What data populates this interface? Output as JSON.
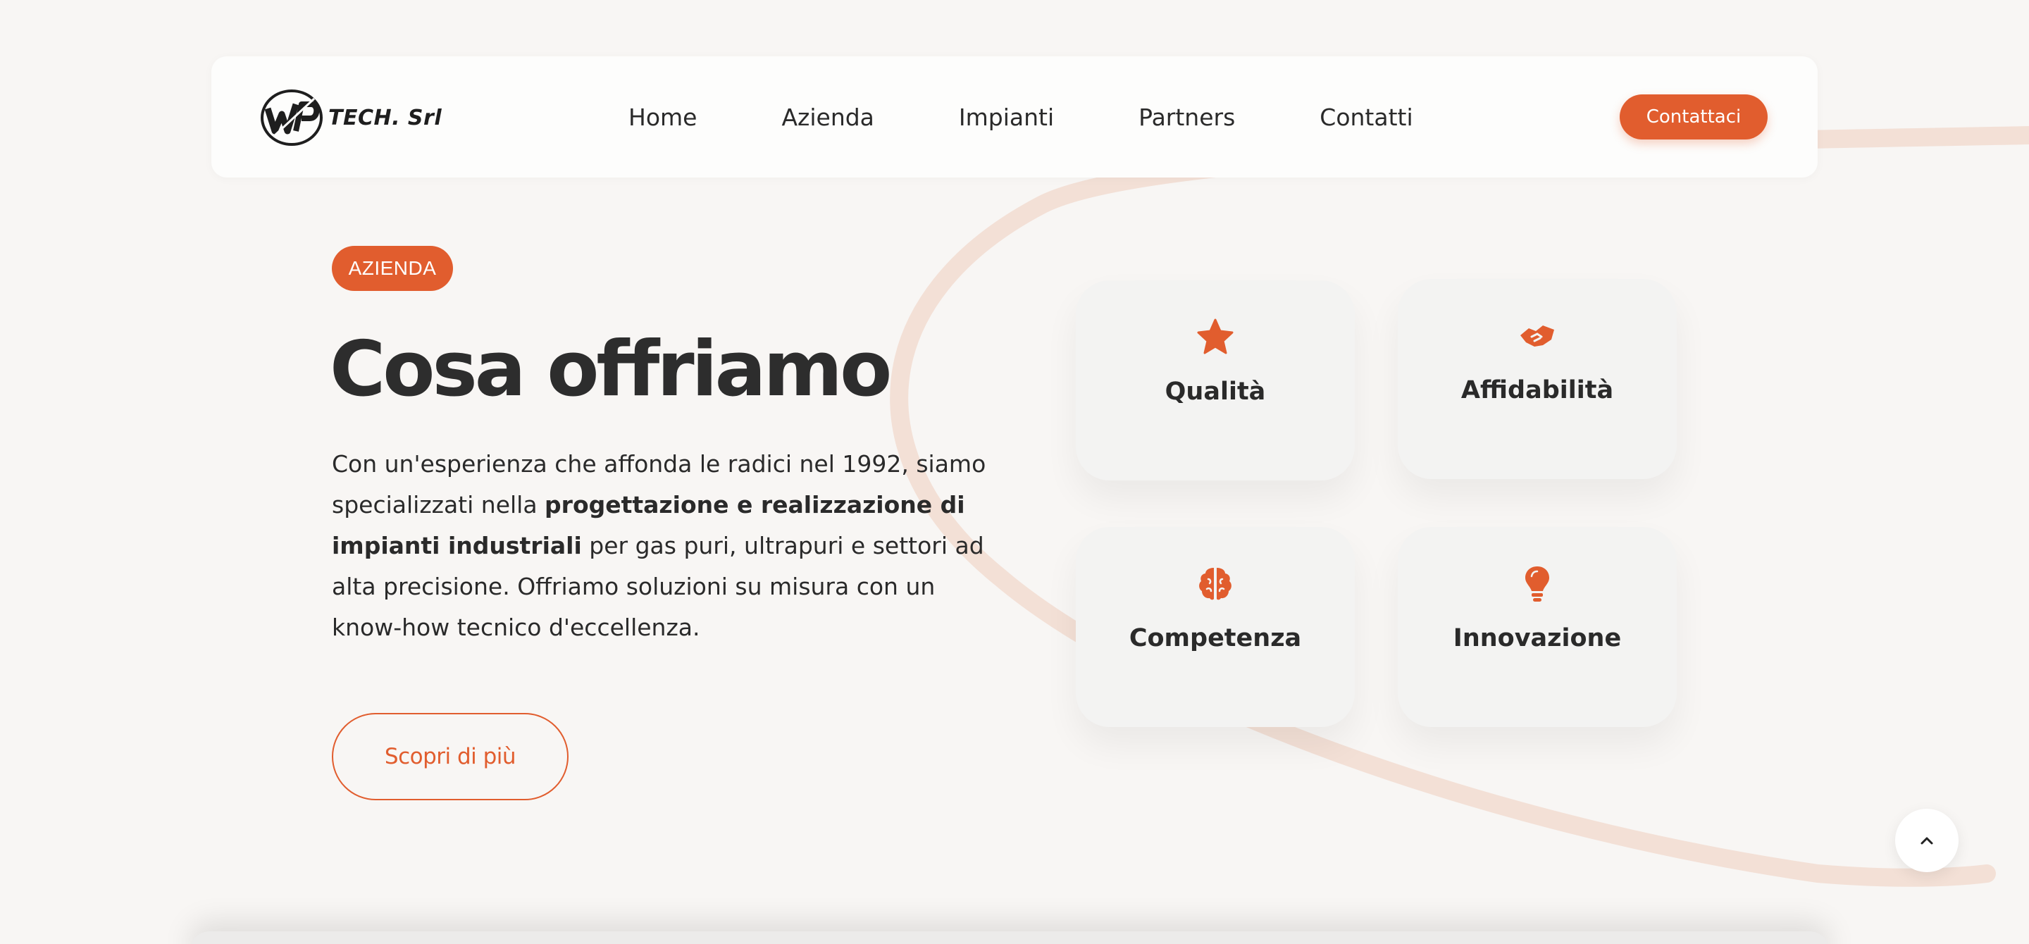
{
  "brand": {
    "logo_text": "TECH. Srl"
  },
  "nav": {
    "links": [
      "Home",
      "Azienda",
      "Impianti",
      "Partners",
      "Contatti"
    ],
    "cta_label": "Contattaci"
  },
  "hero": {
    "badge": "AZIENDA",
    "title": "Cosa offriamo",
    "description": {
      "part1": "Con un'esperienza che affonda le radici nel 1992, siamo specializzati nella ",
      "bold": "progettazione e realizzazione di impianti industriali",
      "part2": " per gas puri, ultrapuri e settori ad alta precisione. Offriamo soluzioni su misura con un know-how tecnico d'eccellenza."
    },
    "cta_label": "Scopri di più"
  },
  "features": [
    {
      "label": "Qualità",
      "icon": "star-icon"
    },
    {
      "label": "Affidabilità",
      "icon": "handshake-icon"
    },
    {
      "label": "Competenza",
      "icon": "brain-icon"
    },
    {
      "label": "Innovazione",
      "icon": "lightbulb-icon"
    }
  ],
  "colors": {
    "accent": "#e15d2e",
    "background": "#f8f6f4",
    "card": "#f3f3f2",
    "text": "#2b2b2b"
  },
  "scroll_top": {
    "icon": "chevron-up-icon"
  }
}
